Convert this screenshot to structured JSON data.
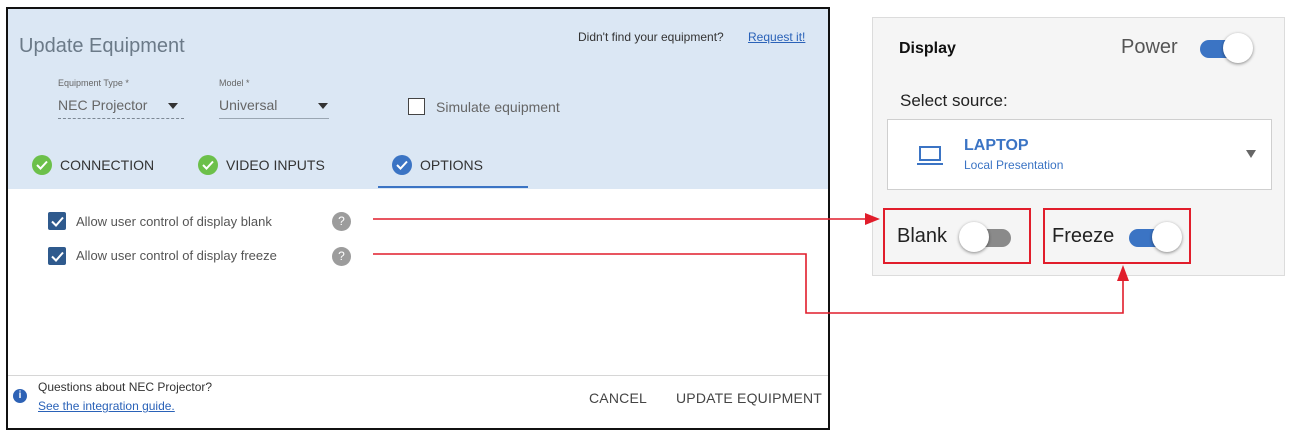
{
  "dialog": {
    "title": "Update Equipment",
    "help_text": "Didn't find your equipment?",
    "help_link": "Request it!",
    "equipment_type": {
      "label": "Equipment Type *",
      "value": "NEC Projector"
    },
    "model": {
      "label": "Model *",
      "value": "Universal"
    },
    "simulate_label": "Simulate equipment",
    "tabs": [
      {
        "label": "CONNECTION",
        "status": "complete"
      },
      {
        "label": "VIDEO INPUTS",
        "status": "complete"
      },
      {
        "label": "OPTIONS",
        "status": "active"
      }
    ],
    "options": [
      {
        "label": "Allow user control of display blank",
        "checked": true,
        "help": "?"
      },
      {
        "label": "Allow user control of display freeze",
        "checked": true,
        "help": "?"
      }
    ],
    "footer": {
      "info_icon": "i",
      "question": "Questions about NEC Projector?",
      "guide_link": "See the integration guide.",
      "cancel": "CANCEL",
      "update": "UPDATE EQUIPMENT"
    }
  },
  "panel": {
    "title": "Display",
    "power_label": "Power",
    "power_on": true,
    "select_source_label": "Select source:",
    "source": {
      "name": "LAPTOP",
      "subtitle": "Local Presentation",
      "icon": "laptop-icon"
    },
    "blank": {
      "label": "Blank",
      "on": false
    },
    "freeze": {
      "label": "Freeze",
      "on": true
    }
  },
  "colors": {
    "accent": "#3b74c4",
    "success": "#6cc04a",
    "annotation": "#e11d2b",
    "checkbox": "#2f5a8d",
    "toggle_off": "#8a8a8a"
  }
}
